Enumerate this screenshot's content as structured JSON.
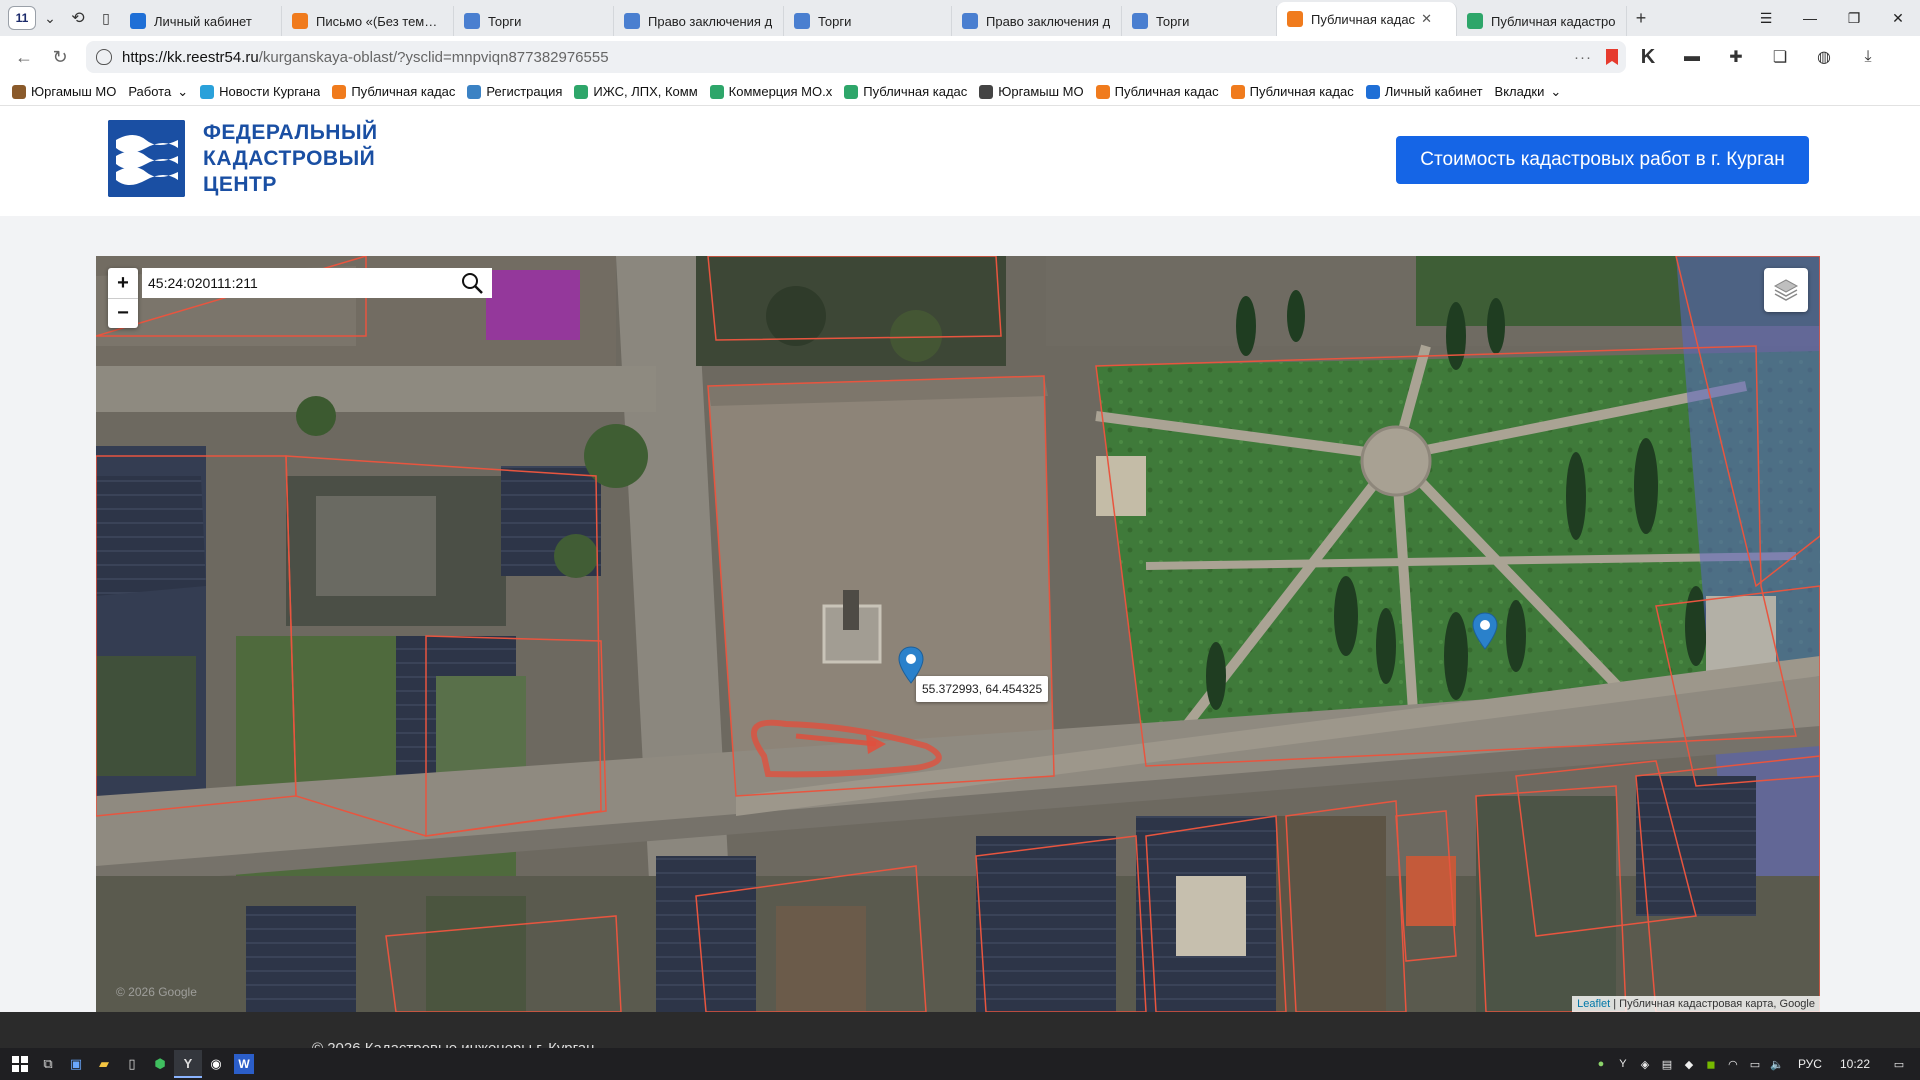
{
  "browser": {
    "tab_count": "11",
    "tabs": [
      {
        "label": "Личный кабинет",
        "icon": "shield-icon",
        "color": "#1f6fd6",
        "w": 162
      },
      {
        "label": "Письмо «(Без темы)»",
        "icon": "mail-icon",
        "color": "#f07b1d",
        "w": 172
      },
      {
        "label": "Торги",
        "icon": "emblem-icon",
        "color": "#4a7fd0",
        "w": 160
      },
      {
        "label": "Право заключения д",
        "icon": "emblem-icon",
        "color": "#4a7fd0",
        "w": 170
      },
      {
        "label": "Торги",
        "icon": "emblem-icon",
        "color": "#4a7fd0",
        "w": 168
      },
      {
        "label": "Право заключения д",
        "icon": "emblem-icon",
        "color": "#4a7fd0",
        "w": 170
      },
      {
        "label": "Торги",
        "icon": "emblem-icon",
        "color": "#4a7fd0",
        "w": 155
      },
      {
        "label": "Публичная кадас",
        "icon": "house-icon",
        "color": "#f07b1d",
        "w": 180,
        "active": true
      },
      {
        "label": "Публичная кадастро",
        "icon": "map-icon",
        "color": "#2ea66a",
        "w": 170
      }
    ],
    "url_host": "https://kk.reestr54.ru",
    "url_path": "/kurganskaya-oblast/?ysclid=mnpviqn877382976555",
    "bookmarks": [
      {
        "label": "Юргамыш МО",
        "icon": "crest-icon"
      },
      {
        "label": "Работа",
        "icon": "",
        "dropdown": true
      },
      {
        "label": "Новости Кургана",
        "icon": "telegram-icon"
      },
      {
        "label": "Публичная кадас",
        "icon": "house-icon"
      },
      {
        "label": "Регистрация",
        "icon": "table-icon"
      },
      {
        "label": "ИЖС, ЛПХ, Комм",
        "icon": "building-icon"
      },
      {
        "label": "Коммерция МО.x",
        "icon": "building-icon"
      },
      {
        "label": "Публичная кадас",
        "icon": "map-icon"
      },
      {
        "label": "Юргамыш МО",
        "icon": "doc-icon"
      },
      {
        "label": "Публичная кадас",
        "icon": "house-icon"
      },
      {
        "label": "Публичная кадас",
        "icon": "house-icon"
      },
      {
        "label": "Личный кабинет",
        "icon": "shield-icon"
      },
      {
        "label": "Вкладки",
        "icon": "",
        "dropdown": true
      }
    ]
  },
  "site": {
    "logo_line1": "ФЕДЕРАЛЬНЫЙ",
    "logo_line2": "КАДАСТРОВЫЙ",
    "logo_line3": "ЦЕНТР",
    "cta_label": "Стоимость кадастровых работ в г. Курган",
    "brand_color": "#1a4fa3",
    "cta_color": "#1565e6",
    "footer_text": "© 2026 Кадастровые инженеры г. Курган"
  },
  "map": {
    "search_value": "45:24:020111:211",
    "zoom_in_label": "+",
    "zoom_out_label": "−",
    "popup_text": "55.372993, 64.454325",
    "attribution_link": "Leaflet",
    "attribution_text": " | Публичная кадастровая карта, Google",
    "watermark": "© 2026 Google",
    "parcel_color": "#e8553f",
    "marker_color": "#2a81cb"
  },
  "taskbar": {
    "lang": "РУС",
    "time": "10:22"
  }
}
